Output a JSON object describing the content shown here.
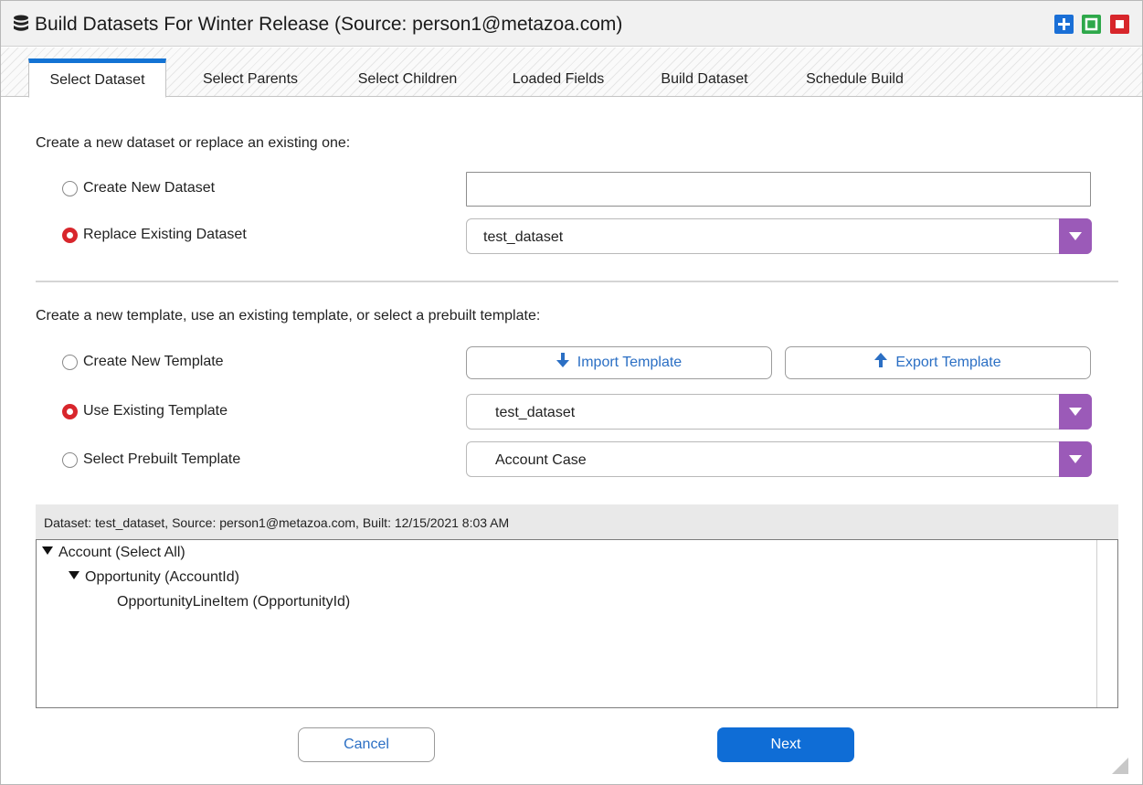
{
  "window": {
    "title": "Build Datasets For Winter Release (Source: person1@metazoa.com)",
    "icon": "database-icon",
    "controls": {
      "plus_color": "#1a6fd6",
      "maximize_color": "#2ea84a",
      "close_color": "#d7262b"
    }
  },
  "tabs": [
    {
      "label": "Select Dataset",
      "active": true
    },
    {
      "label": "Select Parents",
      "active": false
    },
    {
      "label": "Select Children",
      "active": false
    },
    {
      "label": "Loaded Fields",
      "active": false
    },
    {
      "label": "Build Dataset",
      "active": false
    },
    {
      "label": "Schedule Build",
      "active": false
    }
  ],
  "dataset_section": {
    "prompt": "Create a new dataset or replace an existing one:",
    "create_new": {
      "label": "Create New Dataset",
      "selected": false,
      "value": ""
    },
    "replace_existing": {
      "label": "Replace Existing Dataset",
      "selected": true,
      "value": "test_dataset"
    }
  },
  "template_section": {
    "prompt": "Create a new template, use an existing template, or select a prebuilt template:",
    "create_new": {
      "label": "Create New Template",
      "selected": false
    },
    "import_button": "Import Template",
    "export_button": "Export Template",
    "use_existing": {
      "label": "Use Existing Template",
      "selected": true,
      "value": "test_dataset"
    },
    "prebuilt": {
      "label": "Select Prebuilt Template",
      "selected": false,
      "value": "Account Case"
    }
  },
  "tree": {
    "header": "Dataset: test_dataset, Source: person1@metazoa.com, Built: 12/15/2021 8:03 AM",
    "items": [
      {
        "label": "Account (Select All)",
        "expanded": true
      },
      {
        "label": "Opportunity (AccountId)",
        "expanded": true
      },
      {
        "label": "OpportunityLineItem (OpportunityId)",
        "expanded": false
      }
    ]
  },
  "footer": {
    "cancel_label": "Cancel",
    "next_label": "Next"
  },
  "colors": {
    "accent": "#1373d4",
    "radio_selected": "#d8262c",
    "dropdown_arrow": "#9b5ab8",
    "primary_button": "#0f6dd6"
  }
}
